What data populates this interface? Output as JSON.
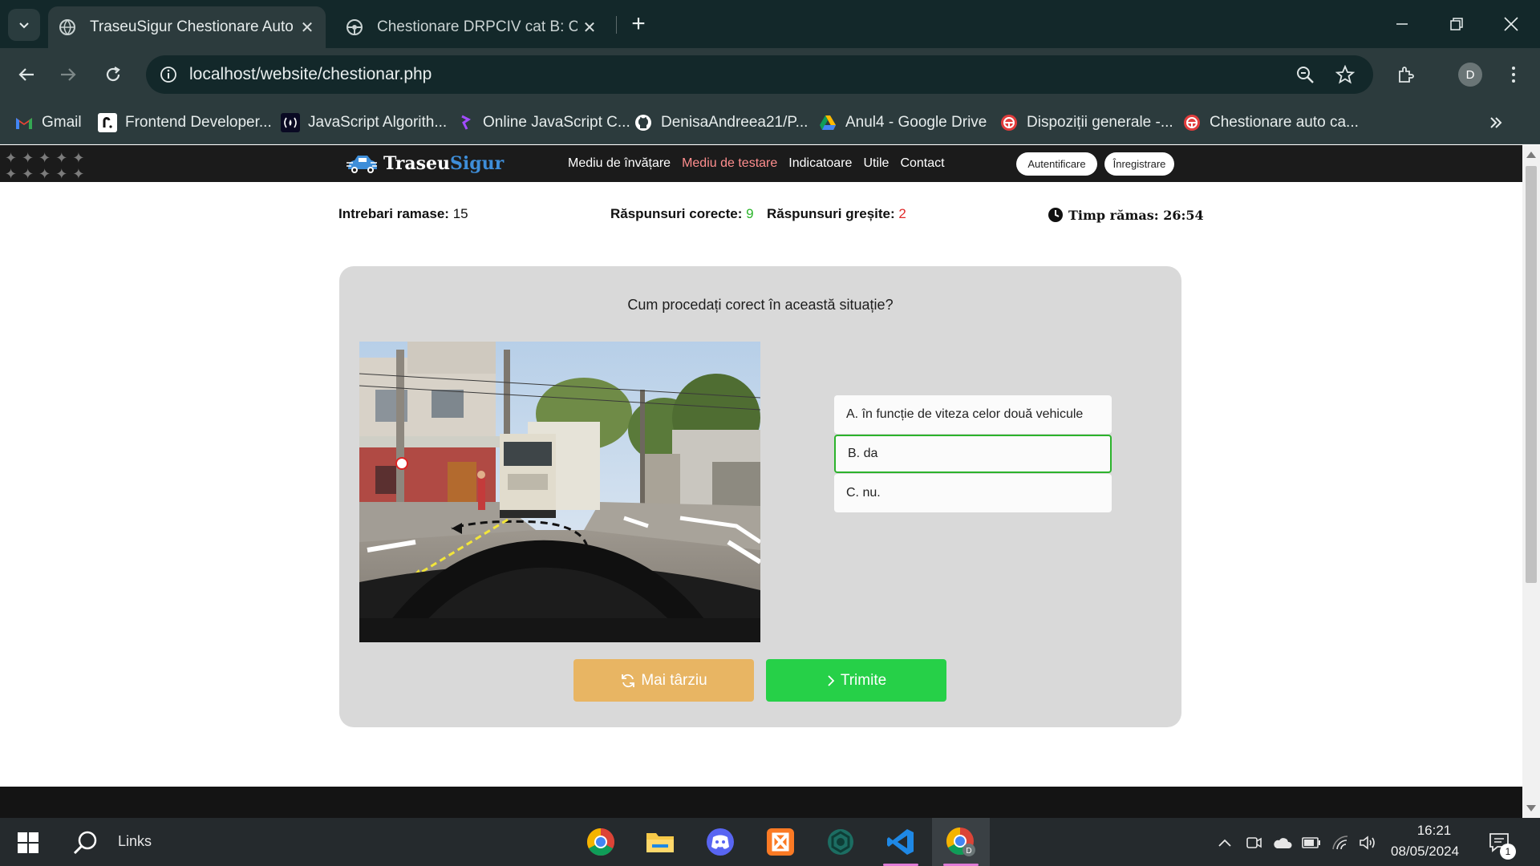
{
  "browser": {
    "tabs": [
      {
        "title": "TraseuSigur Chestionare Auto",
        "active": true
      },
      {
        "title": "Chestionare DRPCIV cat B: Cum",
        "active": false
      }
    ],
    "url": "localhost/website/chestionar.php",
    "profile_initial": "D",
    "bookmarks": [
      {
        "label": "Gmail",
        "icon": "gmail-icon"
      },
      {
        "label": "Frontend Developer...",
        "icon": "frontend-mentor-icon"
      },
      {
        "label": "JavaScript Algorith...",
        "icon": "freecodecamp-icon"
      },
      {
        "label": "Online JavaScript C...",
        "icon": "programiz-icon"
      },
      {
        "label": "DenisaAndreea21/P...",
        "icon": "github-icon"
      },
      {
        "label": "Anul4 - Google Drive",
        "icon": "google-drive-icon"
      },
      {
        "label": "Dispoziții generale -...",
        "icon": "steering-wheel-icon"
      },
      {
        "label": "Chestionare auto ca...",
        "icon": "steering-wheel-icon"
      }
    ]
  },
  "site": {
    "logo_main": "Traseu",
    "logo_accent": "Sigur",
    "menu": [
      "Mediu de învățare",
      "Mediu de testare",
      "Indicatoare",
      "Utile",
      "Contact"
    ],
    "active_menu": "Mediu de testare",
    "login_label": "Autentificare",
    "register_label": "Înregistrare"
  },
  "quiz": {
    "remaining_label": "Intrebari ramase:",
    "remaining_value": "15",
    "correct_label": "Răspunsuri corecte:",
    "correct_value": "9",
    "wrong_label": "Răspunsuri greșite:",
    "wrong_value": "2",
    "timer_text": "Timp rămas: 26:54",
    "question": "Cum procedați corect în această situație?",
    "answers": [
      {
        "text": "A. în funcție de viteza celor două vehicule",
        "selected": false
      },
      {
        "text": "B. da",
        "selected": true
      },
      {
        "text": "C. nu.",
        "selected": false
      }
    ],
    "later_button": "Mai târziu",
    "submit_button": "Trimite"
  },
  "taskbar": {
    "search_label": "Links",
    "apps": [
      "chrome",
      "file-explorer",
      "discord",
      "xampp",
      "chatgpt",
      "vscode",
      "chrome-profile"
    ],
    "time": "16:21",
    "date": "08/05/2024",
    "notification_count": "1"
  },
  "colors": {
    "correct": "#2bb52b",
    "wrong": "#e02b2b",
    "later_button": "#e8b563",
    "submit_button": "#26d048",
    "active_menu": "#ff8e8e",
    "logo_accent": "#3e8ed9"
  }
}
